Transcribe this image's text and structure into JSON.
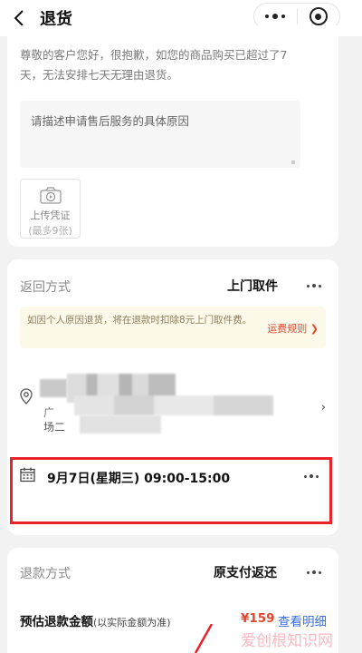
{
  "navbar": {
    "title": "退货"
  },
  "reason_card": {
    "notice": "尊敬的客户您好，很抱歉，如您的商品购买已超过了7天，无法安排七天无理由退货。",
    "reason_placeholder": "请描述申请售后服务的具体原因",
    "upload_label": "上传凭证",
    "upload_limit": "(最多9张)"
  },
  "return_card": {
    "label": "返回方式",
    "value": "上门取件",
    "fee_tip": "如因个人原因退货，将在退款时扣除8元上门取件费。",
    "fee_link": "运费规则 ❯",
    "address_fragment_1": "广",
    "address_fragment_2": "场二",
    "pickup_time": "9月7日(星期三) 09:00-15:00"
  },
  "refund_card": {
    "label": "退款方式",
    "value": "原支付返还",
    "amount_label": "预估退款金额",
    "amount_note": "(以实际金额为准)",
    "amount": "¥159",
    "detail_link": "查看明细"
  },
  "watermark": "爱创根知识网",
  "colors": {
    "accent_red": "#e0472f",
    "highlight_border": "#e8232b",
    "link_blue": "#3a6fd8",
    "tip_bg": "#fdf9e8"
  },
  "icons": [
    "back-arrow-icon",
    "more-dots-icon",
    "target-icon",
    "camera-icon",
    "location-pin-icon",
    "chevron-right-icon",
    "calendar-icon",
    "ellipsis-icon"
  ]
}
